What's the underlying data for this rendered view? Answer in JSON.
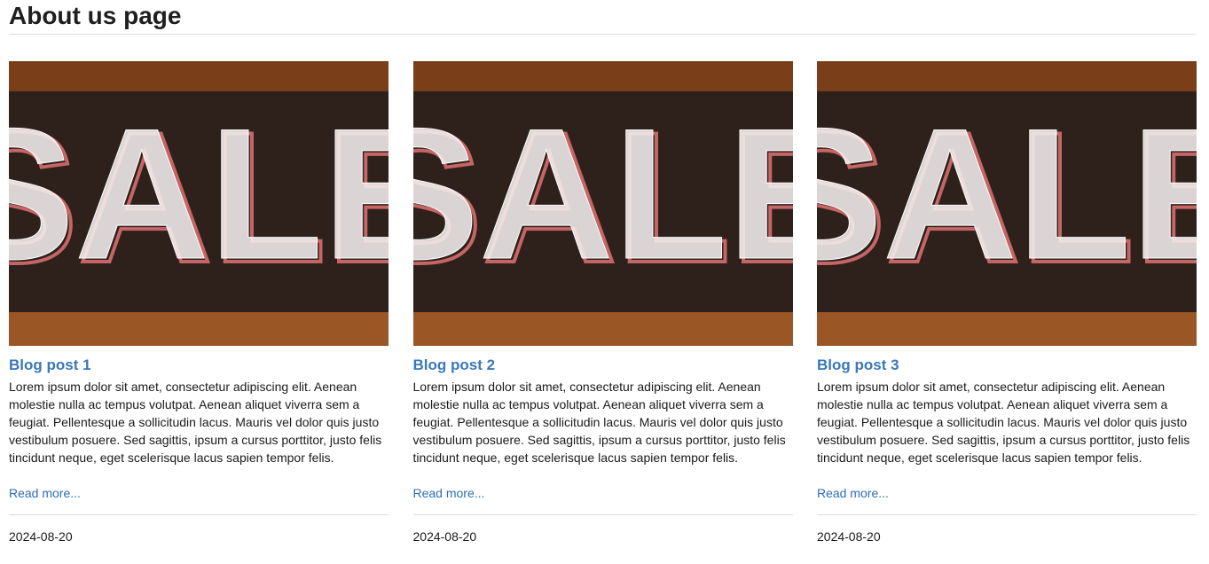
{
  "page": {
    "title": "About us page"
  },
  "posts": [
    {
      "image_icon": "sale-chalkboard-image",
      "image_text": "SALE",
      "title": "Blog post 1",
      "body": "Lorem ipsum dolor sit amet, consectetur adipiscing elit. Aenean molestie nulla ac tempus volutpat. Aenean aliquet viverra sem a feugiat. Pellentesque a sollicitudin lacus. Mauris vel dolor quis justo vestibulum posuere. Sed sagittis, ipsum a cursus porttitor, justo felis tincidunt neque, eget scelerisque lacus sapien tempor felis.",
      "read_more": "Read more...",
      "date": "2024-08-20"
    },
    {
      "image_icon": "sale-chalkboard-image",
      "image_text": "SALE",
      "title": "Blog post 2",
      "body": "Lorem ipsum dolor sit amet, consectetur adipiscing elit. Aenean molestie nulla ac tempus volutpat. Aenean aliquet viverra sem a feugiat. Pellentesque a sollicitudin lacus. Mauris vel dolor quis justo vestibulum posuere. Sed sagittis, ipsum a cursus porttitor, justo felis tincidunt neque, eget scelerisque lacus sapien tempor felis.",
      "read_more": "Read more...",
      "date": "2024-08-20"
    },
    {
      "image_icon": "sale-chalkboard-image",
      "image_text": "SALE",
      "title": "Blog post 3",
      "body": "Lorem ipsum dolor sit amet, consectetur adipiscing elit. Aenean molestie nulla ac tempus volutpat. Aenean aliquet viverra sem a feugiat. Pellentesque a sollicitudin lacus. Mauris vel dolor quis justo vestibulum posuere. Sed sagittis, ipsum a cursus porttitor, justo felis tincidunt neque, eget scelerisque lacus sapien tempor felis.",
      "read_more": "Read more...",
      "date": "2024-08-20"
    }
  ],
  "colors": {
    "link": "#2e6eb8",
    "post_title": "#3a78b8",
    "wood": "#8a4a1f",
    "chalkboard": "#2e211b",
    "chalk": "#f3eeee",
    "chalk_shadow": "#c56565"
  }
}
